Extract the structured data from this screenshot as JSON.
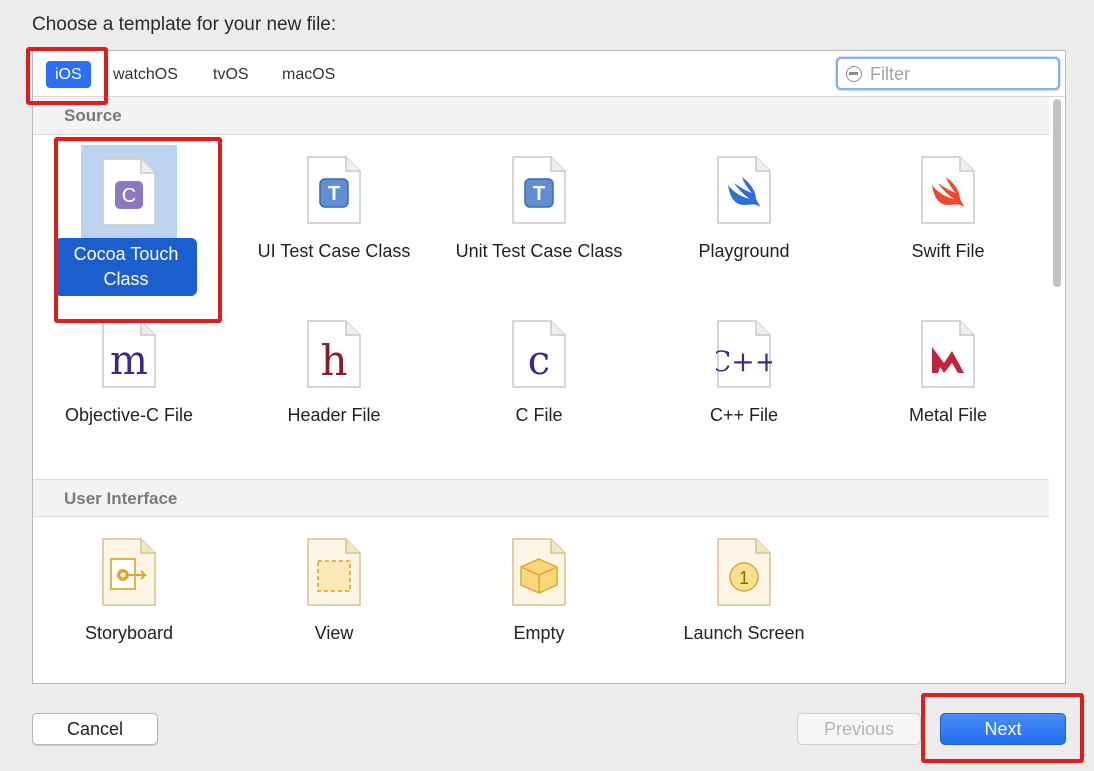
{
  "dialog": {
    "prompt": "Choose a template for your new file:"
  },
  "platforms": {
    "tabs": [
      {
        "label": "iOS",
        "selected": true
      },
      {
        "label": "watchOS",
        "selected": false
      },
      {
        "label": "tvOS",
        "selected": false
      },
      {
        "label": "macOS",
        "selected": false
      }
    ]
  },
  "filter": {
    "placeholder": "Filter",
    "value": ""
  },
  "sections": [
    {
      "header": "Source",
      "items": [
        {
          "label": "Cocoa Touch Class",
          "icon": "cocoa-touch-class-icon",
          "glyph": "C",
          "selected": true
        },
        {
          "label": "UI Test Case Class",
          "icon": "ui-test-case-icon",
          "glyph": "T"
        },
        {
          "label": "Unit Test Case Class",
          "icon": "unit-test-case-icon",
          "glyph": "T"
        },
        {
          "label": "Playground",
          "icon": "swift-playground-icon"
        },
        {
          "label": "Swift File",
          "icon": "swift-file-icon"
        },
        {
          "label": "Objective-C File",
          "icon": "objc-file-icon",
          "glyph": "m"
        },
        {
          "label": "Header File",
          "icon": "header-file-icon",
          "glyph": "h"
        },
        {
          "label": "C File",
          "icon": "c-file-icon",
          "glyph": "c"
        },
        {
          "label": "C++ File",
          "icon": "cpp-file-icon",
          "glyph": "C++"
        },
        {
          "label": "Metal File",
          "icon": "metal-file-icon",
          "glyph": "M"
        }
      ]
    },
    {
      "header": "User Interface",
      "items": [
        {
          "label": "Storyboard",
          "icon": "storyboard-icon"
        },
        {
          "label": "View",
          "icon": "view-icon"
        },
        {
          "label": "Empty",
          "icon": "empty-icon"
        },
        {
          "label": "Launch Screen",
          "icon": "launch-screen-icon",
          "glyph": "1"
        }
      ]
    }
  ],
  "buttons": {
    "cancel": "Cancel",
    "previous": "Previous",
    "next": "Next"
  },
  "colors": {
    "accent": "#2c6ff4",
    "selection": "#1b5fcf",
    "annotation": "#e01d1d"
  }
}
